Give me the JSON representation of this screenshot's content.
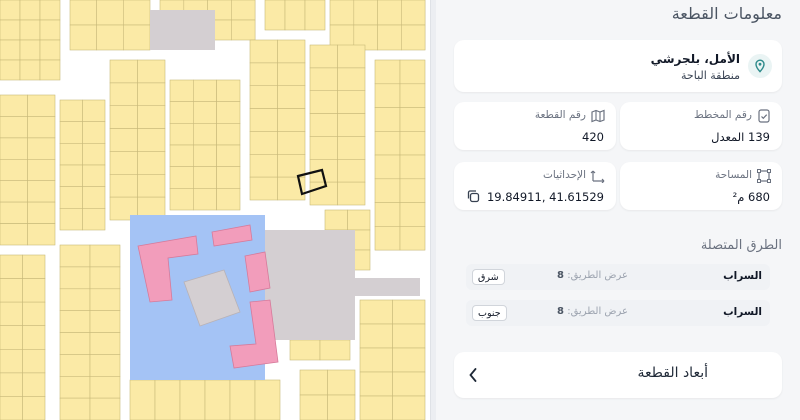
{
  "panel": {
    "title": "معلومات القطعة",
    "location": {
      "name": "الأمل، بلجرشي",
      "region": "منطقة الباحة",
      "icon": "map-pin-icon"
    },
    "plan": {
      "label": "رقم المخطط",
      "value": "139 المعدل",
      "icon": "plan-icon"
    },
    "plot": {
      "label": "رقم القطعة",
      "value": "420",
      "icon": "map-icon"
    },
    "area": {
      "label": "المساحة",
      "value": "680 م²",
      "icon": "area-frame-icon"
    },
    "coords": {
      "label": "الإحداثيات",
      "value": "41.61529 ,19.84911",
      "icon": "arrows-icon",
      "copy_icon": "copy-icon"
    },
    "roads_title": "الطرق المتصلة",
    "roads": [
      {
        "name": "السراب",
        "width_label": "عرض الطريق:",
        "width_value": "8",
        "direction": "شرق"
      },
      {
        "name": "السراب",
        "width_label": "عرض الطريق:",
        "width_value": "8",
        "direction": "جنوب"
      }
    ],
    "dimensions_label": "أبعاد القطعة",
    "dimensions_icon": "chevron-left-icon"
  },
  "colors": {
    "parcel": "#fbeaa6",
    "parcel_outline": "#c8b97a",
    "road": "#ffffff",
    "institution": "#a4c3f5",
    "building": "#f29dbb",
    "grey_lot": "#d4cfd2",
    "accent": "#2e8b8b"
  }
}
